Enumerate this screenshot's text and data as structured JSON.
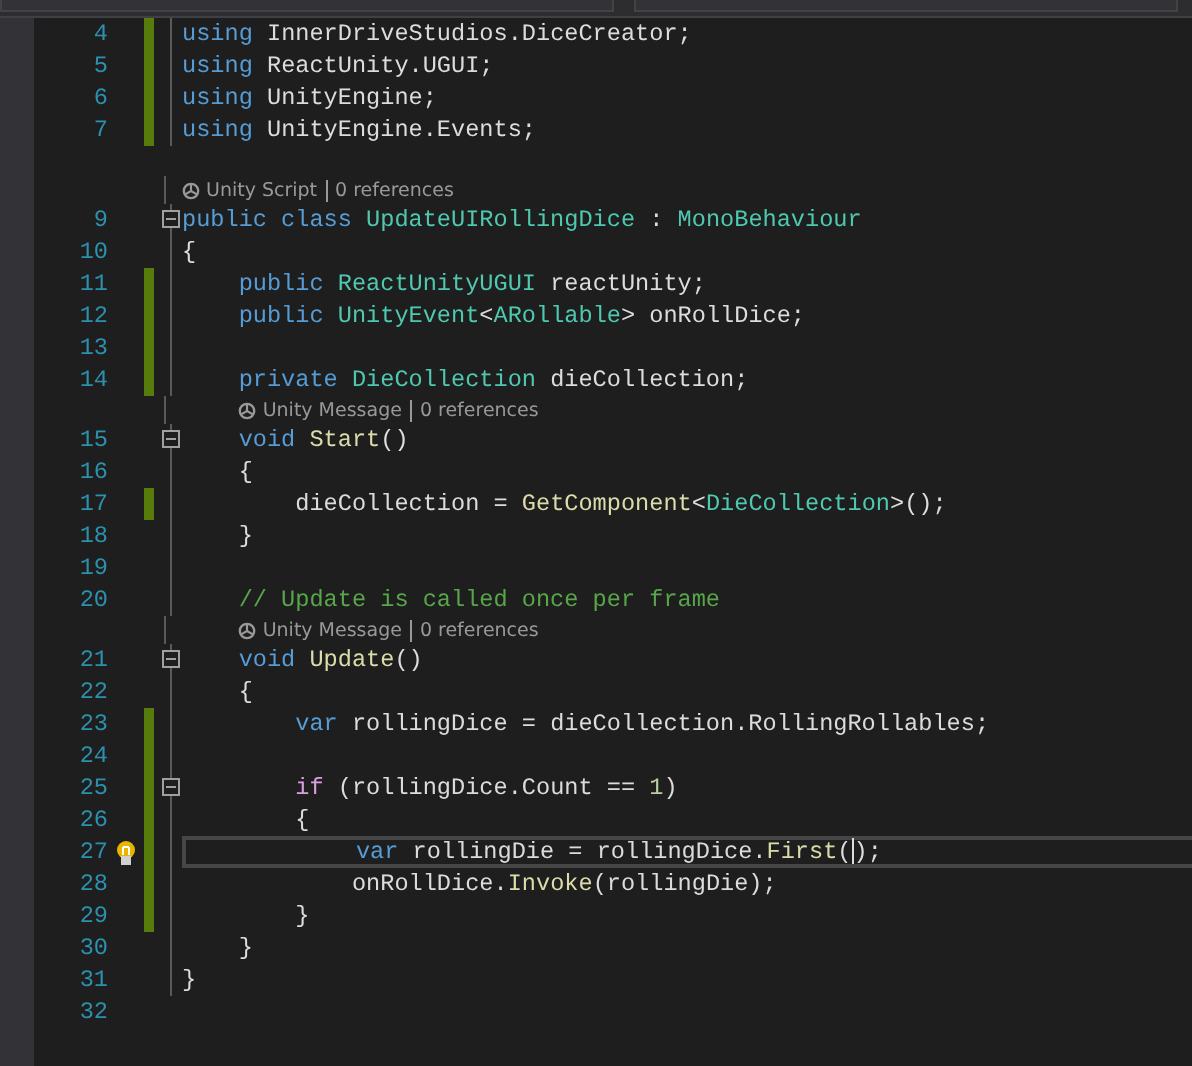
{
  "rows": [
    {
      "kind": "code",
      "number": "4",
      "changed": true,
      "collapsible": false,
      "tokens": [
        {
          "kind": "keyword",
          "text": "using"
        },
        {
          "kind": "plain",
          "text": " InnerDriveStudios.DiceCreator;"
        }
      ]
    },
    {
      "kind": "code",
      "number": "5",
      "changed": true,
      "collapsible": false,
      "tokens": [
        {
          "kind": "keyword",
          "text": "using"
        },
        {
          "kind": "plain",
          "text": " ReactUnity.UGUI;"
        }
      ]
    },
    {
      "kind": "code",
      "number": "6",
      "changed": true,
      "collapsible": false,
      "tokens": [
        {
          "kind": "keyword",
          "text": "using"
        },
        {
          "kind": "plain",
          "text": " UnityEngine;"
        }
      ]
    },
    {
      "kind": "code",
      "number": "7",
      "changed": true,
      "collapsible": false,
      "tokens": [
        {
          "kind": "keyword",
          "text": "using"
        },
        {
          "kind": "plain",
          "text": " UnityEngine.Events;"
        }
      ]
    },
    {
      "kind": "lens",
      "label": "Unity Script",
      "references": "0 references"
    },
    {
      "kind": "code",
      "number": "9",
      "changed": false,
      "collapsible": true,
      "tokens": [
        {
          "kind": "keyword",
          "text": "public class "
        },
        {
          "kind": "type",
          "text": "UpdateUIRollingDice"
        },
        {
          "kind": "plain",
          "text": " : "
        },
        {
          "kind": "type",
          "text": "MonoBehaviour"
        }
      ]
    },
    {
      "kind": "code",
      "number": "10",
      "changed": false,
      "collapsible": false,
      "tokens": [
        {
          "kind": "plain",
          "text": "{"
        }
      ]
    },
    {
      "kind": "code",
      "number": "11",
      "changed": true,
      "collapsible": false,
      "tokens": [
        {
          "kind": "keyword",
          "text": "    public "
        },
        {
          "kind": "type",
          "text": "ReactUnityUGUI"
        },
        {
          "kind": "plain",
          "text": " reactUnity;"
        }
      ]
    },
    {
      "kind": "code",
      "number": "12",
      "changed": true,
      "collapsible": false,
      "tokens": [
        {
          "kind": "keyword",
          "text": "    public "
        },
        {
          "kind": "type",
          "text": "UnityEvent"
        },
        {
          "kind": "plain",
          "text": "<"
        },
        {
          "kind": "type",
          "text": "ARollable"
        },
        {
          "kind": "plain",
          "text": "> onRollDice;"
        }
      ]
    },
    {
      "kind": "code",
      "number": "13",
      "changed": true,
      "collapsible": false,
      "tokens": []
    },
    {
      "kind": "code",
      "number": "14",
      "changed": true,
      "collapsible": false,
      "tokens": [
        {
          "kind": "keyword",
          "text": "    private "
        },
        {
          "kind": "type",
          "text": "DieCollection"
        },
        {
          "kind": "plain",
          "text": " dieCollection;"
        }
      ]
    },
    {
      "kind": "lens",
      "label": "Unity Message",
      "references": "0 references"
    },
    {
      "kind": "code",
      "number": "15",
      "changed": false,
      "collapsible": true,
      "tokens": [
        {
          "kind": "keyword",
          "text": "    void "
        },
        {
          "kind": "method",
          "text": "Start"
        },
        {
          "kind": "plain",
          "text": "()"
        }
      ]
    },
    {
      "kind": "code",
      "number": "16",
      "changed": false,
      "collapsible": false,
      "tokens": [
        {
          "kind": "plain",
          "text": "    {"
        }
      ]
    },
    {
      "kind": "code",
      "number": "17",
      "changed": true,
      "collapsible": false,
      "tokens": [
        {
          "kind": "plain",
          "text": "        dieCollection = "
        },
        {
          "kind": "method",
          "text": "GetComponent"
        },
        {
          "kind": "plain",
          "text": "<"
        },
        {
          "kind": "type",
          "text": "DieCollection"
        },
        {
          "kind": "plain",
          "text": ">();"
        }
      ]
    },
    {
      "kind": "code",
      "number": "18",
      "changed": false,
      "collapsible": false,
      "tokens": [
        {
          "kind": "plain",
          "text": "    }"
        }
      ]
    },
    {
      "kind": "code",
      "number": "19",
      "changed": false,
      "collapsible": false,
      "tokens": []
    },
    {
      "kind": "code",
      "number": "20",
      "changed": false,
      "collapsible": false,
      "tokens": [
        {
          "kind": "comment",
          "text": "    // Update is called once per frame"
        }
      ]
    },
    {
      "kind": "lens",
      "label": "Unity Message",
      "references": "0 references"
    },
    {
      "kind": "code",
      "number": "21",
      "changed": false,
      "collapsible": true,
      "tokens": [
        {
          "kind": "keyword",
          "text": "    void "
        },
        {
          "kind": "method",
          "text": "Update"
        },
        {
          "kind": "plain",
          "text": "()"
        }
      ]
    },
    {
      "kind": "code",
      "number": "22",
      "changed": false,
      "collapsible": false,
      "tokens": [
        {
          "kind": "plain",
          "text": "    {"
        }
      ]
    },
    {
      "kind": "code",
      "number": "23",
      "changed": true,
      "collapsible": false,
      "tokens": [
        {
          "kind": "keyword",
          "text": "        var"
        },
        {
          "kind": "plain",
          "text": " rollingDice = dieCollection.RollingRollables;"
        }
      ]
    },
    {
      "kind": "code",
      "number": "24",
      "changed": true,
      "collapsible": false,
      "tokens": []
    },
    {
      "kind": "code",
      "number": "25",
      "changed": true,
      "collapsible": true,
      "tokens": [
        {
          "kind": "control",
          "text": "        if"
        },
        {
          "kind": "plain",
          "text": " (rollingDice.Count == "
        },
        {
          "kind": "number",
          "text": "1"
        },
        {
          "kind": "plain",
          "text": ")"
        }
      ]
    },
    {
      "kind": "code",
      "number": "26",
      "changed": true,
      "collapsible": false,
      "tokens": [
        {
          "kind": "plain",
          "text": "        {"
        }
      ]
    },
    {
      "kind": "code",
      "number": "27",
      "changed": true,
      "collapsible": false,
      "current": true,
      "lightbulb": true,
      "tokens": [
        {
          "kind": "keyword",
          "text": "            var"
        },
        {
          "kind": "plain",
          "text": " rollingDie = rollingDice."
        },
        {
          "kind": "method",
          "text": "First"
        },
        {
          "kind": "plain",
          "text": "(",
          "caret": true
        },
        {
          "kind": "plain",
          "text": ");"
        }
      ]
    },
    {
      "kind": "code",
      "number": "28",
      "changed": true,
      "collapsible": false,
      "tokens": [
        {
          "kind": "plain",
          "text": "            onRollDice."
        },
        {
          "kind": "method",
          "text": "Invoke"
        },
        {
          "kind": "plain",
          "text": "(rollingDie);"
        }
      ]
    },
    {
      "kind": "code",
      "number": "29",
      "changed": true,
      "collapsible": false,
      "tokens": [
        {
          "kind": "plain",
          "text": "        }"
        }
      ]
    },
    {
      "kind": "code",
      "number": "30",
      "changed": false,
      "collapsible": false,
      "tokens": [
        {
          "kind": "plain",
          "text": "    }"
        }
      ]
    },
    {
      "kind": "code",
      "number": "31",
      "changed": false,
      "collapsible": false,
      "tokens": [
        {
          "kind": "plain",
          "text": "}"
        }
      ]
    },
    {
      "kind": "code",
      "number": "32",
      "changed": false,
      "collapsible": false,
      "tokens": []
    }
  ]
}
